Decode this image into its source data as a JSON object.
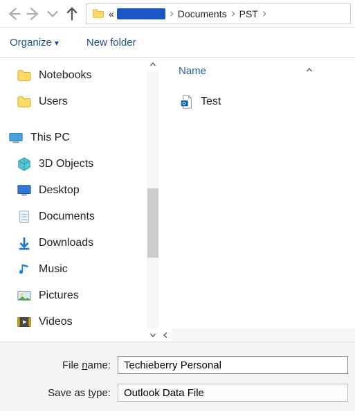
{
  "nav": {
    "path_prefix": "«",
    "crumbs": [
      "Documents",
      "PST"
    ]
  },
  "toolbar": {
    "organize": "Organize",
    "newfolder": "New folder"
  },
  "sidebar": {
    "items_top": [
      {
        "label": "Notebooks"
      },
      {
        "label": "Users"
      }
    ],
    "this_pc": "This PC",
    "items_pc": [
      {
        "label": "3D Objects"
      },
      {
        "label": "Desktop"
      },
      {
        "label": "Documents"
      },
      {
        "label": "Downloads"
      },
      {
        "label": "Music"
      },
      {
        "label": "Pictures"
      },
      {
        "label": "Videos"
      }
    ]
  },
  "content": {
    "header_name": "Name",
    "files": [
      {
        "label": "Test"
      }
    ]
  },
  "form": {
    "filename_label_pre": "File ",
    "filename_label_u": "n",
    "filename_label_post": "ame:",
    "filename_value": "Techieberry Personal",
    "savetype_label_pre": "Save as ",
    "savetype_label_u": "t",
    "savetype_label_post": "ype:",
    "savetype_value": "Outlook Data File"
  }
}
